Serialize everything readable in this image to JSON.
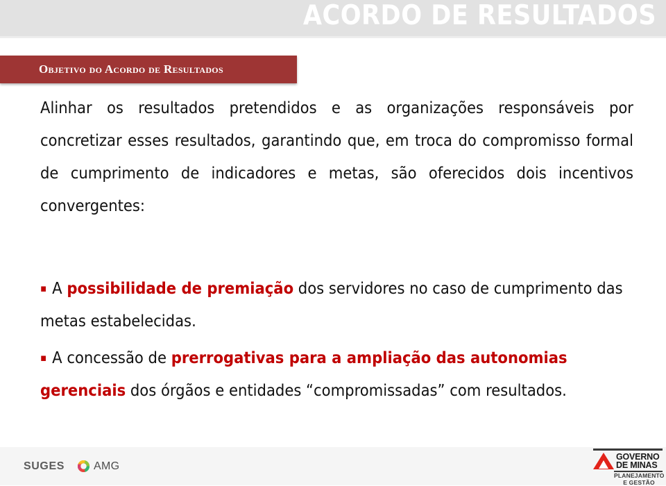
{
  "header": {
    "deck_title": "ACORDO DE RESULTADOS",
    "band_color": "#e2e2e2",
    "title_color": "#ffffff"
  },
  "section": {
    "banner_label": "Objetivo do Acordo de Resultados",
    "banner_color": "#9e3534"
  },
  "body": {
    "paragraph": "Alinhar os resultados pretendidos e as organizações responsáveis por concretizar esses resultados, garantindo que, em troca do compromisso formal de cumprimento de indicadores e metas, são oferecidos dois incentivos convergentes:",
    "bullet_marker": "▪"
  },
  "bullets": [
    {
      "marker": "▪",
      "lead": "A ",
      "highlight": "possibilidade de premiação",
      "tail": " dos servidores no caso de cumprimento das metas estabelecidas.",
      "highlight_color": "#c00000"
    },
    {
      "marker": "▪",
      "lead": "A concessão de ",
      "highlight": "prerrogativas para a ampliação das autonomias gerenciais",
      "tail": " dos órgãos e entidades “compromissadas”  com resultados.",
      "highlight_color": "#c00000"
    }
  ],
  "footer": {
    "suges_label": "SUGES",
    "amg_label": "AMG",
    "gov_line1": "GOVERNO",
    "gov_line2": "DE MINAS",
    "gov_sub_line1": "PLANEJAMENTO",
    "gov_sub_line2": "E GESTÃO",
    "background": "#f5f5f5"
  }
}
